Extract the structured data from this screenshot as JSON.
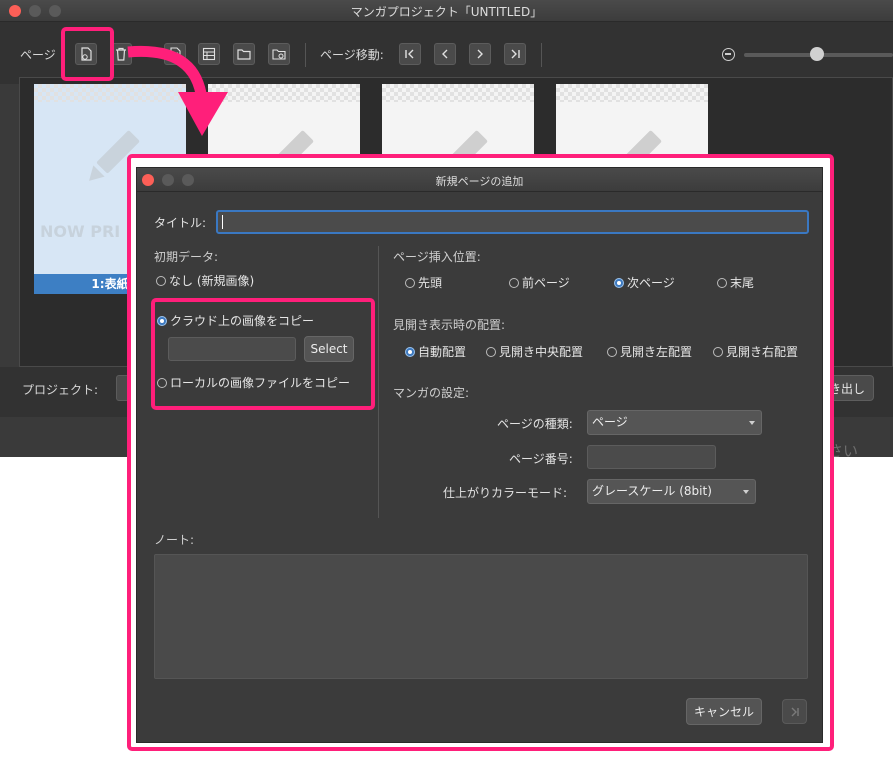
{
  "main_window": {
    "title": "マンガプロジェクト「UNTITLED」",
    "toolbar": {
      "page_label": "ページ",
      "page_move_label": "ページ移動:"
    },
    "thumbnails": [
      {
        "watermark": "NOW PRI",
        "caption": "1:表紙",
        "selected": true
      },
      {
        "watermark": "",
        "caption": "",
        "selected": false
      },
      {
        "watermark": "",
        "caption": "",
        "selected": false
      },
      {
        "watermark": "",
        "caption": "",
        "selected": false
      }
    ],
    "bottom": {
      "project_label": "プロジェクト:",
      "export_label": "き出し"
    },
    "background_text_tail": "さい"
  },
  "dialog": {
    "title": "新規ページの追加",
    "title_field_label": "タイトル:",
    "title_field_value": "",
    "initial_data": {
      "label": "初期データ:",
      "options": [
        {
          "label": "なし (新規画像)",
          "selected": false
        },
        {
          "label": "クラウド上の画像をコピー",
          "selected": true
        },
        {
          "label": "ローカルの画像ファイルをコピー",
          "selected": false
        }
      ],
      "cloud_path_value": "",
      "select_button": "Select"
    },
    "insert_position": {
      "label": "ページ挿入位置:",
      "options": [
        {
          "label": "先頭",
          "selected": false
        },
        {
          "label": "前ページ",
          "selected": false
        },
        {
          "label": "次ページ",
          "selected": true
        },
        {
          "label": "末尾",
          "selected": false
        }
      ]
    },
    "spread_layout": {
      "label": "見開き表示時の配置:",
      "options": [
        {
          "label": "自動配置",
          "selected": true
        },
        {
          "label": "見開き中央配置",
          "selected": false
        },
        {
          "label": "見開き左配置",
          "selected": false
        },
        {
          "label": "見開き右配置",
          "selected": false
        }
      ]
    },
    "manga_settings": {
      "label": "マンガの設定:",
      "page_type_label": "ページの種類:",
      "page_type_value": "ページ",
      "page_number_label": "ページ番号:",
      "page_number_value": "",
      "color_mode_label": "仕上がりカラーモード:",
      "color_mode_value": "グレースケール (8bit)"
    },
    "note_label": "ノート:",
    "cancel_button": "キャンセル",
    "ok_button_icon": "skip-forward-icon"
  },
  "colors": {
    "highlight": "#ff1f7a",
    "selection_blue": "#3d7fc4",
    "window_bg": "#3a3a3a"
  }
}
